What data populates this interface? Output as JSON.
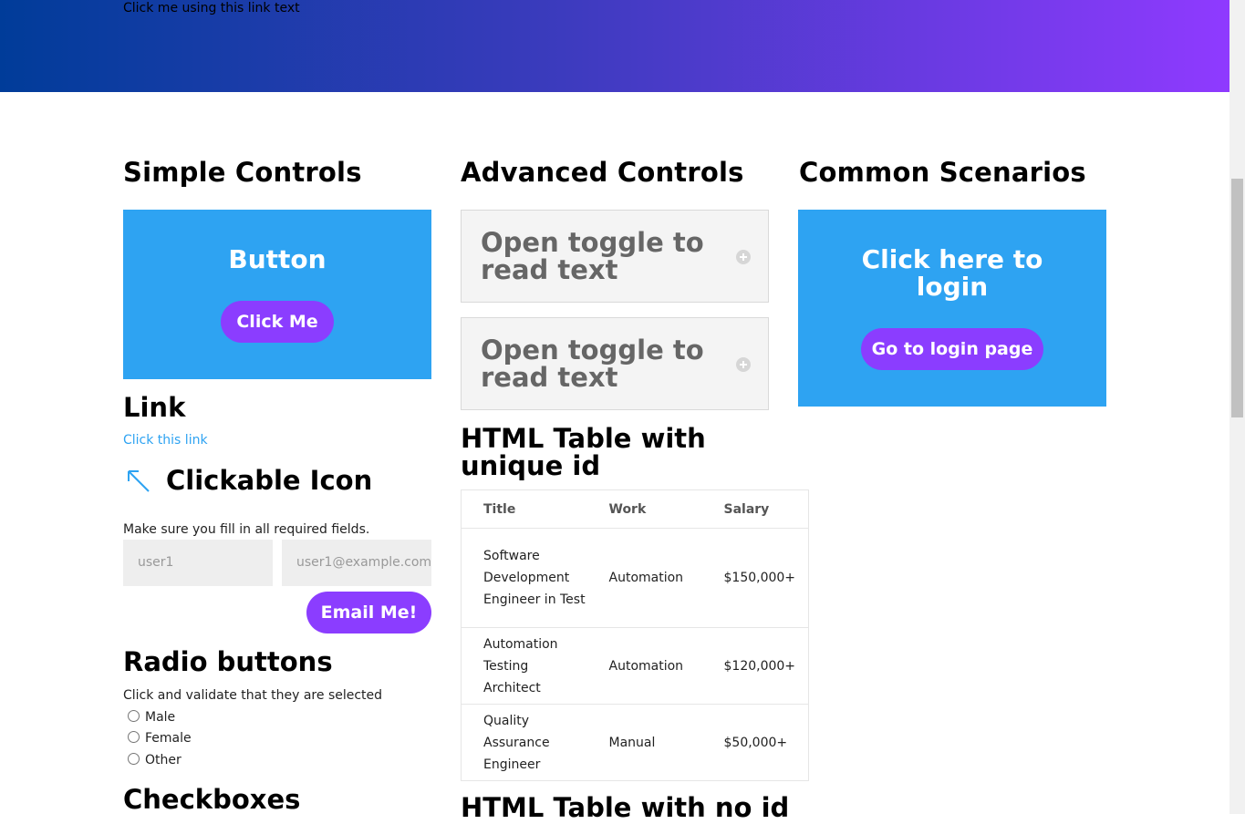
{
  "hero": {
    "text": "Click me using this link text"
  },
  "columns": {
    "simple": "Simple Controls",
    "advanced": "Advanced Controls",
    "common": "Common Scenarios"
  },
  "simple": {
    "button_box_title": "Button",
    "button_label": "Click Me",
    "link_heading": "Link",
    "link_text": "Click this link",
    "icon_heading": "Clickable Icon",
    "form_note": "Make sure you fill in all required fields.",
    "name_placeholder": "user1",
    "email_placeholder": "user1@example.com",
    "email_button": "Email Me!",
    "radio_heading": "Radio buttons",
    "radio_note": "Click and validate that they are selected",
    "radios": [
      "Male",
      "Female",
      "Other"
    ],
    "checkbox_heading": "Checkboxes"
  },
  "advanced": {
    "toggles": [
      "Open toggle to read text",
      "Open toggle to read text"
    ],
    "table_heading": "HTML Table with unique id",
    "table": {
      "headers": [
        "Title",
        "Work",
        "Salary"
      ],
      "rows": [
        [
          "Software Development Engineer in Test",
          "Automation",
          "$150,000+"
        ],
        [
          "Automation Testing Architect",
          "Automation",
          "$120,000+"
        ],
        [
          "Quality Assurance Engineer",
          "Manual",
          "$50,000+"
        ]
      ]
    },
    "table2_heading": "HTML Table with no id"
  },
  "common": {
    "login_title": "Click here to login",
    "login_button": "Go to login page"
  },
  "colors": {
    "accent_blue": "#2ea3f2",
    "accent_purple": "#8b3dff"
  }
}
